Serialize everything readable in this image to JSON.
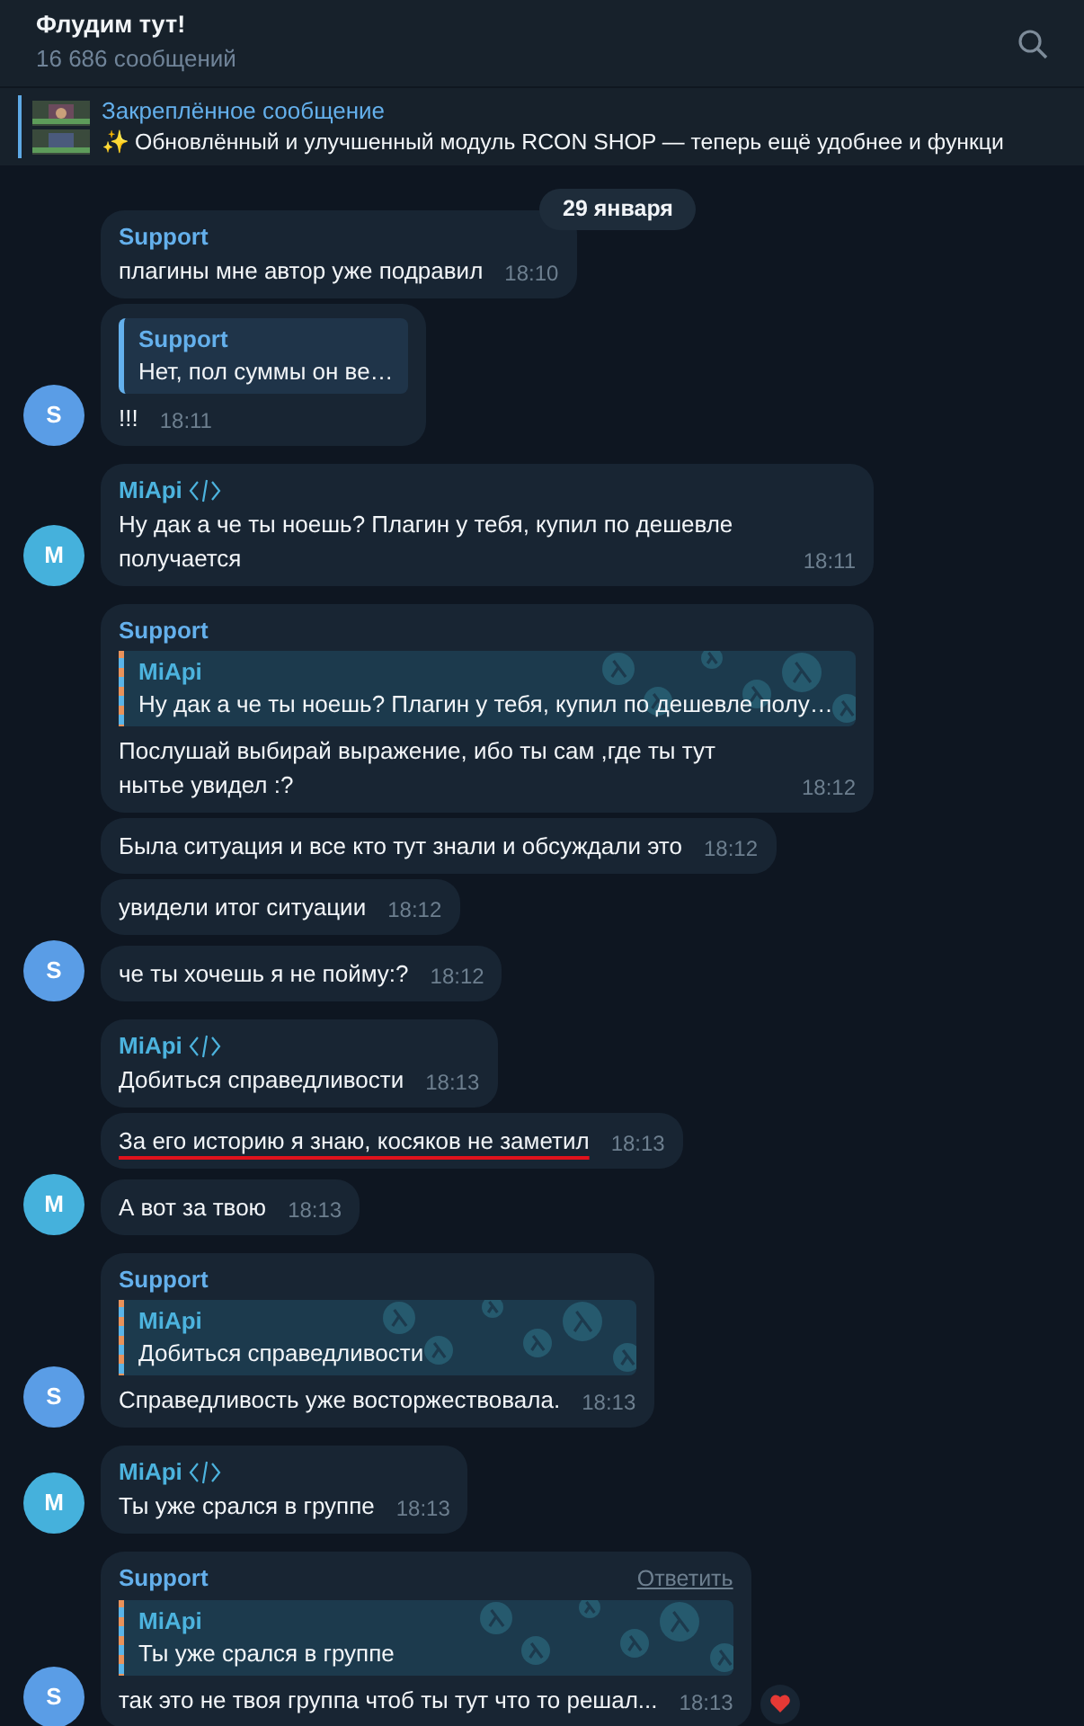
{
  "header": {
    "title": "Флудим тут!",
    "subtitle": "16 686 сообщений"
  },
  "pinned": {
    "label": "Закреплённое сообщение",
    "text": "✨ Обновлённый и улучшенный модуль RCON SHOP — теперь ещё удобнее и функци"
  },
  "date_badge": "29 января",
  "messages": [
    {
      "sender": {
        "name": "Support",
        "color": "#64b0ec"
      },
      "text": "плагины мне автор уже подравил",
      "time": "18:10"
    },
    {
      "reply": {
        "kind": "plain",
        "name": "Support",
        "color": "#64b0ec",
        "text": "Нет, пол суммы он ве…"
      },
      "text": "!!!",
      "time": "18:11",
      "avatar": {
        "letter": "S",
        "color": "#5a9de6"
      }
    },
    {
      "sender": {
        "name": "MiApi",
        "color": "#4cb3de"
      },
      "dev_badge": true,
      "text": "Ну дак а че ты ноешь? Плагин у тебя, купил по дешевле получается",
      "time": "18:11",
      "avatar": {
        "letter": "M",
        "color": "#45b1dc"
      }
    },
    {
      "sender": {
        "name": "Support",
        "color": "#64b0ec"
      },
      "reply": {
        "kind": "pattern",
        "name": "MiApi",
        "color": "#4cb3de",
        "text": "Ну дак а че ты ноешь? Плагин у тебя, купил по дешевле полу…"
      },
      "text": "Послушай выбирай выражение, ибо ты сам ,где ты тут нытье увидел :?",
      "time": "18:12"
    },
    {
      "text": "Была ситуация и все кто тут знали и обсуждали это",
      "time": "18:12"
    },
    {
      "text": "увидели итог ситуации",
      "time": "18:12"
    },
    {
      "text": "че ты хочешь я не пойму:?",
      "time": "18:12",
      "avatar": {
        "letter": "S",
        "color": "#5a9de6"
      }
    },
    {
      "sender": {
        "name": "MiApi",
        "color": "#4cb3de"
      },
      "dev_badge": true,
      "text": "Добиться справедливости",
      "time": "18:13"
    },
    {
      "text": "За его историю я знаю, косяков не заметил",
      "time": "18:13",
      "underlined": true
    },
    {
      "text": "А вот за твою",
      "time": "18:13",
      "avatar": {
        "letter": "M",
        "color": "#45b1dc"
      }
    },
    {
      "sender": {
        "name": "Support",
        "color": "#64b0ec"
      },
      "reply": {
        "kind": "pattern",
        "name": "MiApi",
        "color": "#4cb3de",
        "text": "Добиться справедливости"
      },
      "text": "Справедливость уже восторжествовала.",
      "time": "18:13",
      "avatar": {
        "letter": "S",
        "color": "#5a9de6"
      }
    },
    {
      "sender": {
        "name": "MiApi",
        "color": "#4cb3de"
      },
      "dev_badge": true,
      "text": "Ты уже срался в группе",
      "time": "18:13",
      "avatar": {
        "letter": "M",
        "color": "#45b1dc"
      }
    },
    {
      "sender": {
        "name": "Support",
        "color": "#64b0ec"
      },
      "reply_action": "Ответить",
      "reply": {
        "kind": "pattern",
        "name": "MiApi",
        "color": "#4cb3de",
        "text": "Ты уже срался в группе"
      },
      "text": "так это не твоя группа чтоб ты тут что то решал...",
      "time": "18:13",
      "reacted": true,
      "avatar": {
        "letter": "S",
        "color": "#5a9de6"
      }
    }
  ]
}
